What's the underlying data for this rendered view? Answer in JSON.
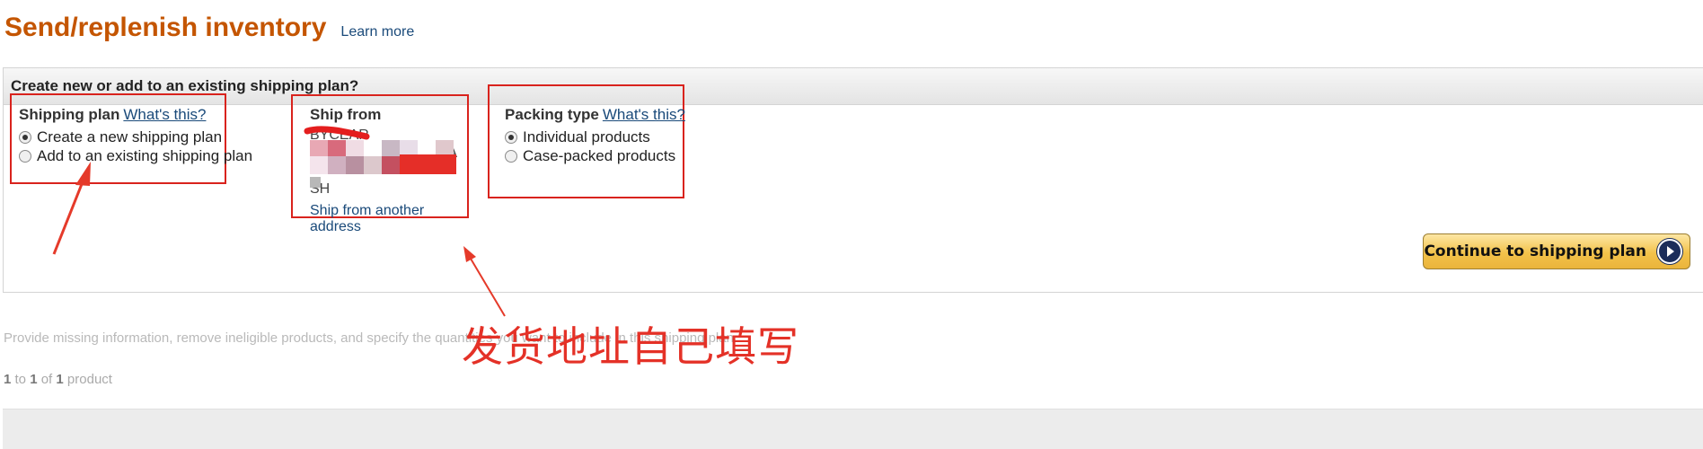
{
  "page": {
    "title": "Send/replenish inventory",
    "learn_more": "Learn more"
  },
  "panel": {
    "header": "Create new or add to an existing shipping plan?"
  },
  "shipping_plan": {
    "heading": "Shipping plan",
    "help": "What's this?",
    "options": [
      {
        "label": "Create a new shipping plan",
        "checked": true
      },
      {
        "label": "Add to an existing shipping plan",
        "checked": false
      }
    ]
  },
  "ship_from": {
    "heading": "Ship from",
    "address_visible_fragments": [
      "BYCEAR",
      "EA",
      "SH"
    ],
    "another_address_link": "Ship from another address"
  },
  "packing_type": {
    "heading": "Packing type",
    "help": "What's this?",
    "options": [
      {
        "label": "Individual products",
        "checked": true
      },
      {
        "label": "Case-packed products",
        "checked": false
      }
    ]
  },
  "continue_button": {
    "label": "Continue to shipping plan"
  },
  "info": {
    "text": "Provide missing information, remove ineligible products, and specify the quantities you want to include in this shipping plan.",
    "count_prefix": "1",
    "count_mid": " to ",
    "count_first": "1",
    "count_of": " of ",
    "count_total": "1",
    "count_suffix": " product"
  },
  "annotation": {
    "text": "发货地址自己填写",
    "color": "#e43127"
  },
  "colors": {
    "title": "#c45500",
    "link": "#1a4a7a",
    "highlight_box": "#d9231d",
    "button": "#f3c24a"
  }
}
